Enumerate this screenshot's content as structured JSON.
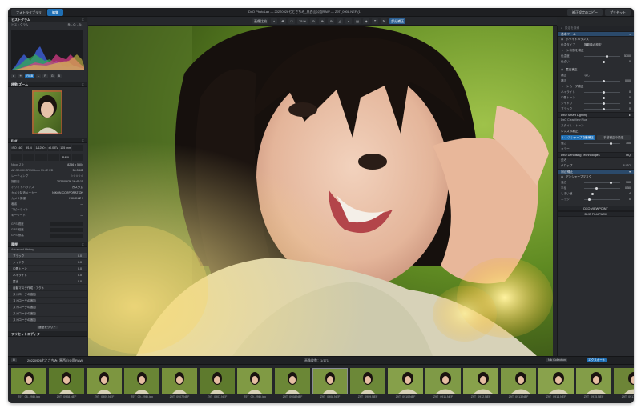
{
  "titlebar": {
    "tabs": [
      "フォトライブラリ",
      "編集"
    ],
    "title": "DxO PhotoLab — 20220926七とさちみ_黒西山公園RAW — Z9T_0908.NEF (1)",
    "right_buttons": [
      "補正設定のコピー",
      "プリセット"
    ]
  },
  "toolbar": {
    "items": [
      "画像比較",
      "+",
      "✥",
      "□",
      "75 %",
      "⊙",
      "⊕",
      "⊘",
      "△",
      "◐",
      "▤",
      "◈",
      "⌗",
      "✎",
      "部分補正"
    ]
  },
  "left": {
    "histogram_title": "ヒストグラム",
    "histogram_label": "ヒストグラム",
    "rgb_readout": "R: - G: - B: -",
    "channels": [
      "RGB",
      "L",
      "R",
      "G",
      "B"
    ],
    "nav_title": "移動/ズーム",
    "exif_title": "Exif",
    "exif_grid": [
      "ISO 160",
      "f/1.4",
      "1/1250 s",
      "±0.0 EV",
      "105 mm",
      ""
    ],
    "exif_row2": [
      "",
      "",
      "",
      "",
      "RAW",
      ""
    ],
    "camera_row": {
      "label": "Nikon Z 9",
      "value": "8256 x 5504"
    },
    "lens_row": {
      "label": "AF-S NIKKOR 105mm f/1.4E ED",
      "value": "50.3 MB"
    },
    "fields": [
      {
        "k": "レーティング",
        "v": "☆☆☆☆☆"
      },
      {
        "k": "撮影日",
        "v": "2022/09/26 16:45:15"
      },
      {
        "k": "ホワイトバランス",
        "v": "カスタム"
      },
      {
        "k": "カメラ製造メーカー",
        "v": "NIKON CORPORATION"
      },
      {
        "k": "カメラ機種",
        "v": "NIKON Z 9"
      },
      {
        "k": "著者",
        "v": "—"
      },
      {
        "k": "コピーライト",
        "v": "—"
      },
      {
        "k": "キーワード",
        "v": "—"
      }
    ],
    "gps": [
      "GPS 緯度",
      "GPS 経度",
      "GPS 標高"
    ],
    "history_title": "履歴",
    "history_sub": "Advanced History",
    "history_items": [
      {
        "k": "ブラック",
        "v": "0.0"
      },
      {
        "k": "シャドウ",
        "v": "0.0"
      },
      {
        "k": "中間トーン",
        "v": "0.0"
      },
      {
        "k": "ハイライト",
        "v": "0.0"
      },
      {
        "k": "露出",
        "v": "0.0"
      },
      {
        "k": "自動マスク作成・アクト",
        "v": ""
      },
      {
        "k": "ストロークの追加",
        "v": ""
      },
      {
        "k": "ストロークの追加",
        "v": ""
      },
      {
        "k": "ストロークの追加",
        "v": ""
      },
      {
        "k": "ストロークの追加",
        "v": ""
      },
      {
        "k": "ストロークの追加",
        "v": ""
      }
    ],
    "history_button": "履歴をクリア",
    "preset_title": "プリセットエディタ"
  },
  "right": {
    "search_placeholder": "設定を検索",
    "section_basic": "基本ツール",
    "wb_title": "ホワイトバランス",
    "wb_mode": {
      "k": "色温タイプ",
      "v": "撮影時の設定"
    },
    "tone_title": "トーン状態を補正",
    "tone_rows": [
      {
        "k": "色温度",
        "v": "5300"
      },
      {
        "k": "色合い",
        "v": "0"
      }
    ],
    "exposure_title": "露光補正",
    "exposure_mode": {
      "k": "補正",
      "v": "なし"
    },
    "exposure_row": {
      "k": "補正",
      "v": "0.00"
    },
    "curve_title": "トーンカーブ補正",
    "curve_rows": [
      {
        "k": "ハイライト",
        "v": "0"
      },
      {
        "k": "中間トーン",
        "v": "0"
      },
      {
        "k": "シャドウ",
        "v": "0"
      },
      {
        "k": "ブラック",
        "v": "0"
      }
    ],
    "smart_lighting": "DxO Smart Lighting",
    "clearview": "DxO ClearView Plus",
    "selective_tone": "スタイル・トーン",
    "lens_title": "レンズの補正",
    "lens_buttons": [
      "レンズシャープ自動補正",
      "手動補正の設定"
    ],
    "lens_row": {
      "k": "強さ",
      "v": "100"
    },
    "color_title": "カラー",
    "denoise": "DxO Denoising Technologies",
    "denoise_val": "HQ",
    "geometry": "歪み",
    "crop": {
      "k": "クロップ",
      "v": "AUTO"
    },
    "vignette": "周辺補正",
    "unsharp_title": "アンシャープマスク",
    "unsharp_rows": [
      {
        "k": "強さ",
        "v": "100"
      },
      {
        "k": "半径",
        "v": "0.50"
      },
      {
        "k": "しきい値",
        "v": "4"
      },
      {
        "k": "エッジ",
        "v": "0"
      }
    ],
    "viewpoint": "DXO VIEWPOINT",
    "filmpack": "DXO FILMPACK"
  },
  "filmstrip_bar": {
    "folder": "20220926七とさちみ_黒西山公園RAW",
    "count": "画像枚数：1/171",
    "project": "Nik Collection",
    "export": "エクスポート"
  },
  "filmstrip": [
    {
      "name": "Z9T_08...(98).jpg",
      "sel": false
    },
    {
      "name": "Z9T_0908.NEF",
      "sel": false
    },
    {
      "name": "Z9T_0909.NEF",
      "sel": false
    },
    {
      "name": "Z9T_09...(96).jpg",
      "sel": false
    },
    {
      "name": "Z9T_0907.NEF",
      "sel": false
    },
    {
      "name": "Z9T_0907.NEF",
      "sel": false
    },
    {
      "name": "Z9T_09...(96).jpg",
      "sel": false
    },
    {
      "name": "Z9T_0908.NEF",
      "sel": false
    },
    {
      "name": "Z9T_0908.NEF",
      "sel": true
    },
    {
      "name": "Z9T_0909.NEF",
      "sel": false
    },
    {
      "name": "Z9T_0910.NEF",
      "sel": false
    },
    {
      "name": "Z9T_0911.NEF",
      "sel": false
    },
    {
      "name": "Z9T_0912.NEF",
      "sel": false
    },
    {
      "name": "Z9T_0913.NEF",
      "sel": false
    },
    {
      "name": "Z9T_0914.NEF",
      "sel": false
    },
    {
      "name": "Z9T_0915.NEF",
      "sel": false
    },
    {
      "name": "Z9T_0917.NEF",
      "sel": false
    }
  ]
}
